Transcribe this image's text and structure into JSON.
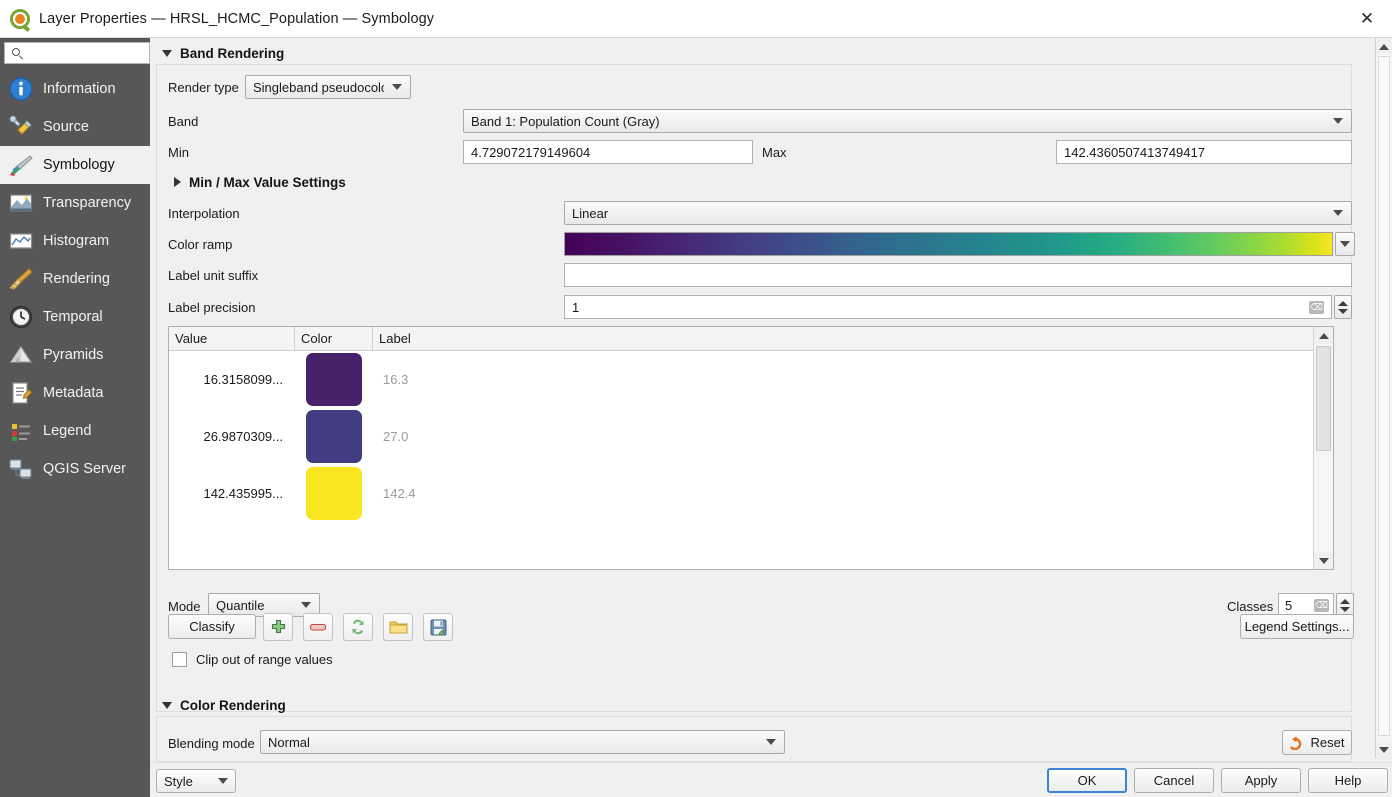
{
  "window": {
    "title": "Layer Properties — HRSL_HCMC_Population — Symbology",
    "close_label": "✕",
    "app_icon": "qgis-logo-icon"
  },
  "sidebar": {
    "search": {
      "value": "",
      "placeholder": ""
    },
    "items": [
      {
        "label": "Information",
        "icon": "information-icon",
        "active": false
      },
      {
        "label": "Source",
        "icon": "source-wrench-icon",
        "active": false
      },
      {
        "label": "Symbology",
        "icon": "symbology-brush-icon",
        "active": true
      },
      {
        "label": "Transparency",
        "icon": "transparency-icon",
        "active": false
      },
      {
        "label": "Histogram",
        "icon": "histogram-icon",
        "active": false
      },
      {
        "label": "Rendering",
        "icon": "rendering-broom-icon",
        "active": false
      },
      {
        "label": "Temporal",
        "icon": "clock-icon",
        "active": false
      },
      {
        "label": "Pyramids",
        "icon": "pyramids-icon",
        "active": false
      },
      {
        "label": "Metadata",
        "icon": "metadata-pencil-icon",
        "active": false
      },
      {
        "label": "Legend",
        "icon": "legend-icon",
        "active": false
      },
      {
        "label": "QGIS Server",
        "icon": "server-icon",
        "active": false
      }
    ]
  },
  "band_rendering": {
    "section_title": "Band Rendering",
    "render_type_label": "Render type",
    "render_type_value": "Singleband pseudocolor",
    "band_label": "Band",
    "band_value": "Band 1: Population Count (Gray)",
    "min_label": "Min",
    "min_value": "4.729072179149604",
    "max_label": "Max",
    "max_value": "142.4360507413749417",
    "minmax_settings_title": "Min / Max Value Settings",
    "interpolation_label": "Interpolation",
    "interpolation_value": "Linear",
    "color_ramp_label": "Color ramp",
    "color_ramp_name": "viridis",
    "label_unit_suffix_label": "Label unit suffix",
    "label_unit_suffix_value": "",
    "label_precision_label": "Label precision",
    "label_precision_value": "1"
  },
  "table": {
    "columns": [
      "Value",
      "Color",
      "Label"
    ],
    "rows": [
      {
        "value": "16.3158099...",
        "color": "#472169",
        "label": "16.3"
      },
      {
        "value": "26.9870309...",
        "color": "#423D80",
        "label": "27.0"
      },
      {
        "value": "142.435995...",
        "color": "#F8E621",
        "label": "142.4"
      }
    ]
  },
  "classify_bar": {
    "mode_label": "Mode",
    "mode_value": "Quantile",
    "classify_label": "Classify",
    "add_icon": "add-plus-icon",
    "remove_icon": "remove-minus-icon",
    "sort_icon": "flip-colors-icon",
    "open_icon": "open-folder-icon",
    "save_icon": "save-disk-icon",
    "classes_label": "Classes",
    "classes_value": "5",
    "legend_settings_label": "Legend Settings...",
    "clip_checkbox_label": "Clip out of range values",
    "clip_checked": false
  },
  "color_rendering": {
    "section_title": "Color Rendering",
    "blending_mode_label": "Blending mode",
    "blending_mode_value": "Normal",
    "reset_label": "Reset",
    "reset_icon": "undo-arrow-icon"
  },
  "footer": {
    "style_label": "Style",
    "ok_label": "OK",
    "cancel_label": "Cancel",
    "apply_label": "Apply",
    "help_label": "Help"
  },
  "colors": {
    "sidebar_bg": "#575757",
    "accent_focus": "#3a86d6",
    "panel_bg": "#f0f0f0",
    "reset_orange": "#e2721f"
  }
}
